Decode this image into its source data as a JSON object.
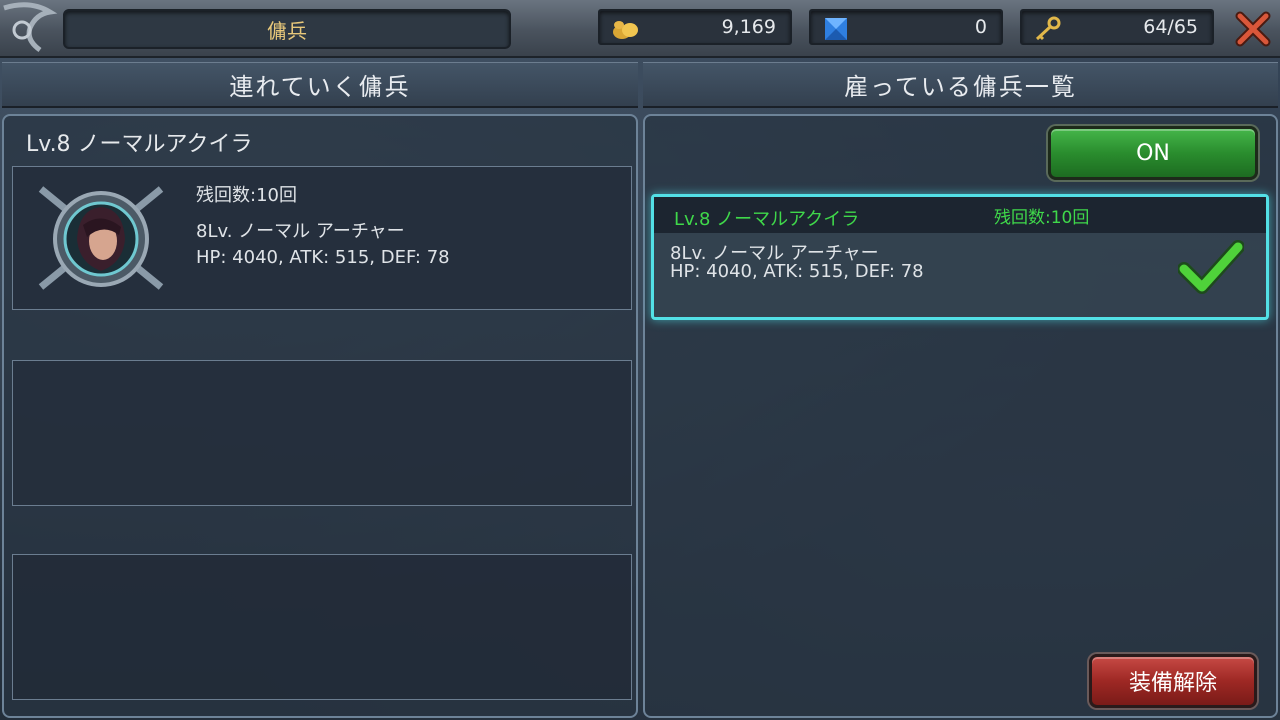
{
  "header": {
    "title": "傭兵",
    "gold": "9,169",
    "gems": "0",
    "keys": "64/65"
  },
  "left": {
    "header": "連れていく傭兵",
    "merc_name": "Lv.8 ノーマルアクイラ",
    "remaining": "残回数:10回",
    "class": "8Lv. ノーマル アーチャー",
    "stats": "HP: 4040, ATK: 515, DEF: 78"
  },
  "right": {
    "header": "雇っている傭兵一覧",
    "toggle_label": "ON",
    "card": {
      "name": "Lv.8 ノーマルアクイラ",
      "remaining": "残回数:10回",
      "class": "8Lv. ノーマル アーチャー",
      "stats": "HP: 4040, ATK: 515, DEF: 78"
    },
    "unequip_label": "装備解除"
  },
  "icons": {
    "gold": "coins-icon",
    "gems": "gem-icon",
    "keys": "key-icon",
    "close": "close-icon",
    "check": "check-icon"
  },
  "colors": {
    "accent_green": "#3fd84a",
    "highlight_cyan": "#53e0e6",
    "title_gold": "#e8c87a"
  }
}
